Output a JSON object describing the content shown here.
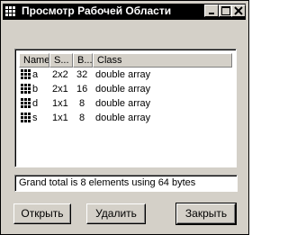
{
  "window": {
    "title": "Просмотр Рабочей Области",
    "controls": {
      "minimize": "_",
      "close": "×"
    }
  },
  "table": {
    "columns": [
      "Name",
      "S...",
      "B...",
      "Class"
    ],
    "rows": [
      {
        "name": "a",
        "size": "2x2",
        "bytes": "32",
        "class": "double array"
      },
      {
        "name": "b",
        "size": "2x1",
        "bytes": "16",
        "class": "double array"
      },
      {
        "name": "d",
        "size": "1x1",
        "bytes": "8",
        "class": "double array"
      },
      {
        "name": "s",
        "size": "1x1",
        "bytes": "8",
        "class": "double array"
      }
    ]
  },
  "status": {
    "text": "Grand total is 8 elements using 64 bytes"
  },
  "buttons": {
    "open": "Открыть",
    "delete": "Удалить",
    "close": "Закрыть"
  }
}
